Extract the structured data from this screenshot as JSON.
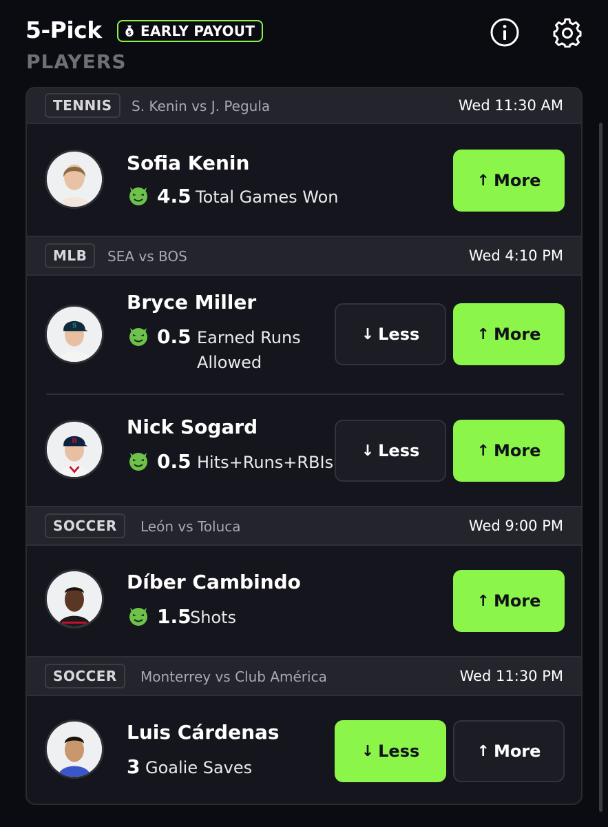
{
  "header": {
    "title": "5-Pick",
    "badge_label": "EARLY PAYOUT",
    "section_label": "PLAYERS",
    "icons": [
      "money-bag-icon",
      "info-icon",
      "gear-icon"
    ]
  },
  "colors": {
    "accent": "#8cf54a",
    "background": "#0b0b12",
    "card": "#15151d",
    "group_header": "#24242c"
  },
  "groups": [
    {
      "sport": "TENNIS",
      "matchup": "S. Kenin vs J. Pegula",
      "time": "Wed 11:30 AM",
      "picks": [
        {
          "player": "Sofia Kenin",
          "line": "4.5",
          "stat": "Total Games Won",
          "has_demon_icon": true,
          "less_label": "",
          "more_label": "More",
          "selected": "more"
        }
      ]
    },
    {
      "sport": "MLB",
      "matchup": "SEA vs BOS",
      "time": "Wed 4:10 PM",
      "picks": [
        {
          "player": "Bryce Miller",
          "line": "0.5",
          "stat_line1": "Earned Runs",
          "stat_line2": "Allowed",
          "has_demon_icon": true,
          "less_label": "Less",
          "more_label": "More",
          "selected": "more"
        },
        {
          "player": "Nick Sogard",
          "line": "0.5",
          "stat": "Hits+Runs+RBIs",
          "has_demon_icon": true,
          "less_label": "Less",
          "more_label": "More",
          "selected": "more"
        }
      ]
    },
    {
      "sport": "SOCCER",
      "matchup": "León vs Toluca",
      "time": "Wed 9:00 PM",
      "picks": [
        {
          "player": "Díber Cambindo",
          "line": "1.5",
          "stat": "Shots",
          "has_demon_icon": true,
          "less_label": "",
          "more_label": "More",
          "selected": "more"
        }
      ]
    },
    {
      "sport": "SOCCER",
      "matchup": "Monterrey vs Club América",
      "time": "Wed 11:30 PM",
      "picks": [
        {
          "player": "Luis Cárdenas",
          "line": "3",
          "stat": "Goalie Saves",
          "has_demon_icon": false,
          "less_label": "Less",
          "more_label": "More",
          "selected": "less"
        }
      ]
    }
  ]
}
